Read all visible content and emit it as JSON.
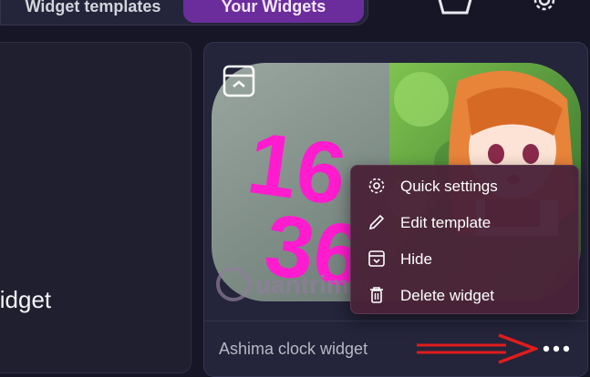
{
  "tabs": {
    "templates": "Widget templates",
    "your_widgets": "Your Widgets"
  },
  "left_card": {
    "title": "widget"
  },
  "widget": {
    "name": "Ashima clock widget",
    "clock_digits": "16 36"
  },
  "menu": {
    "items": [
      {
        "label": "Quick settings",
        "icon": "gear-icon"
      },
      {
        "label": "Edit template",
        "icon": "pencil-icon"
      },
      {
        "label": "Hide",
        "icon": "hide-icon"
      },
      {
        "label": "Delete widget",
        "icon": "trash-icon"
      }
    ]
  },
  "watermark": "uantrimang",
  "colors": {
    "accent": "#6c2d9c",
    "menu_bg": "#4a2238",
    "arrow": "#e01c1c",
    "clock": "#ff1ccf"
  }
}
